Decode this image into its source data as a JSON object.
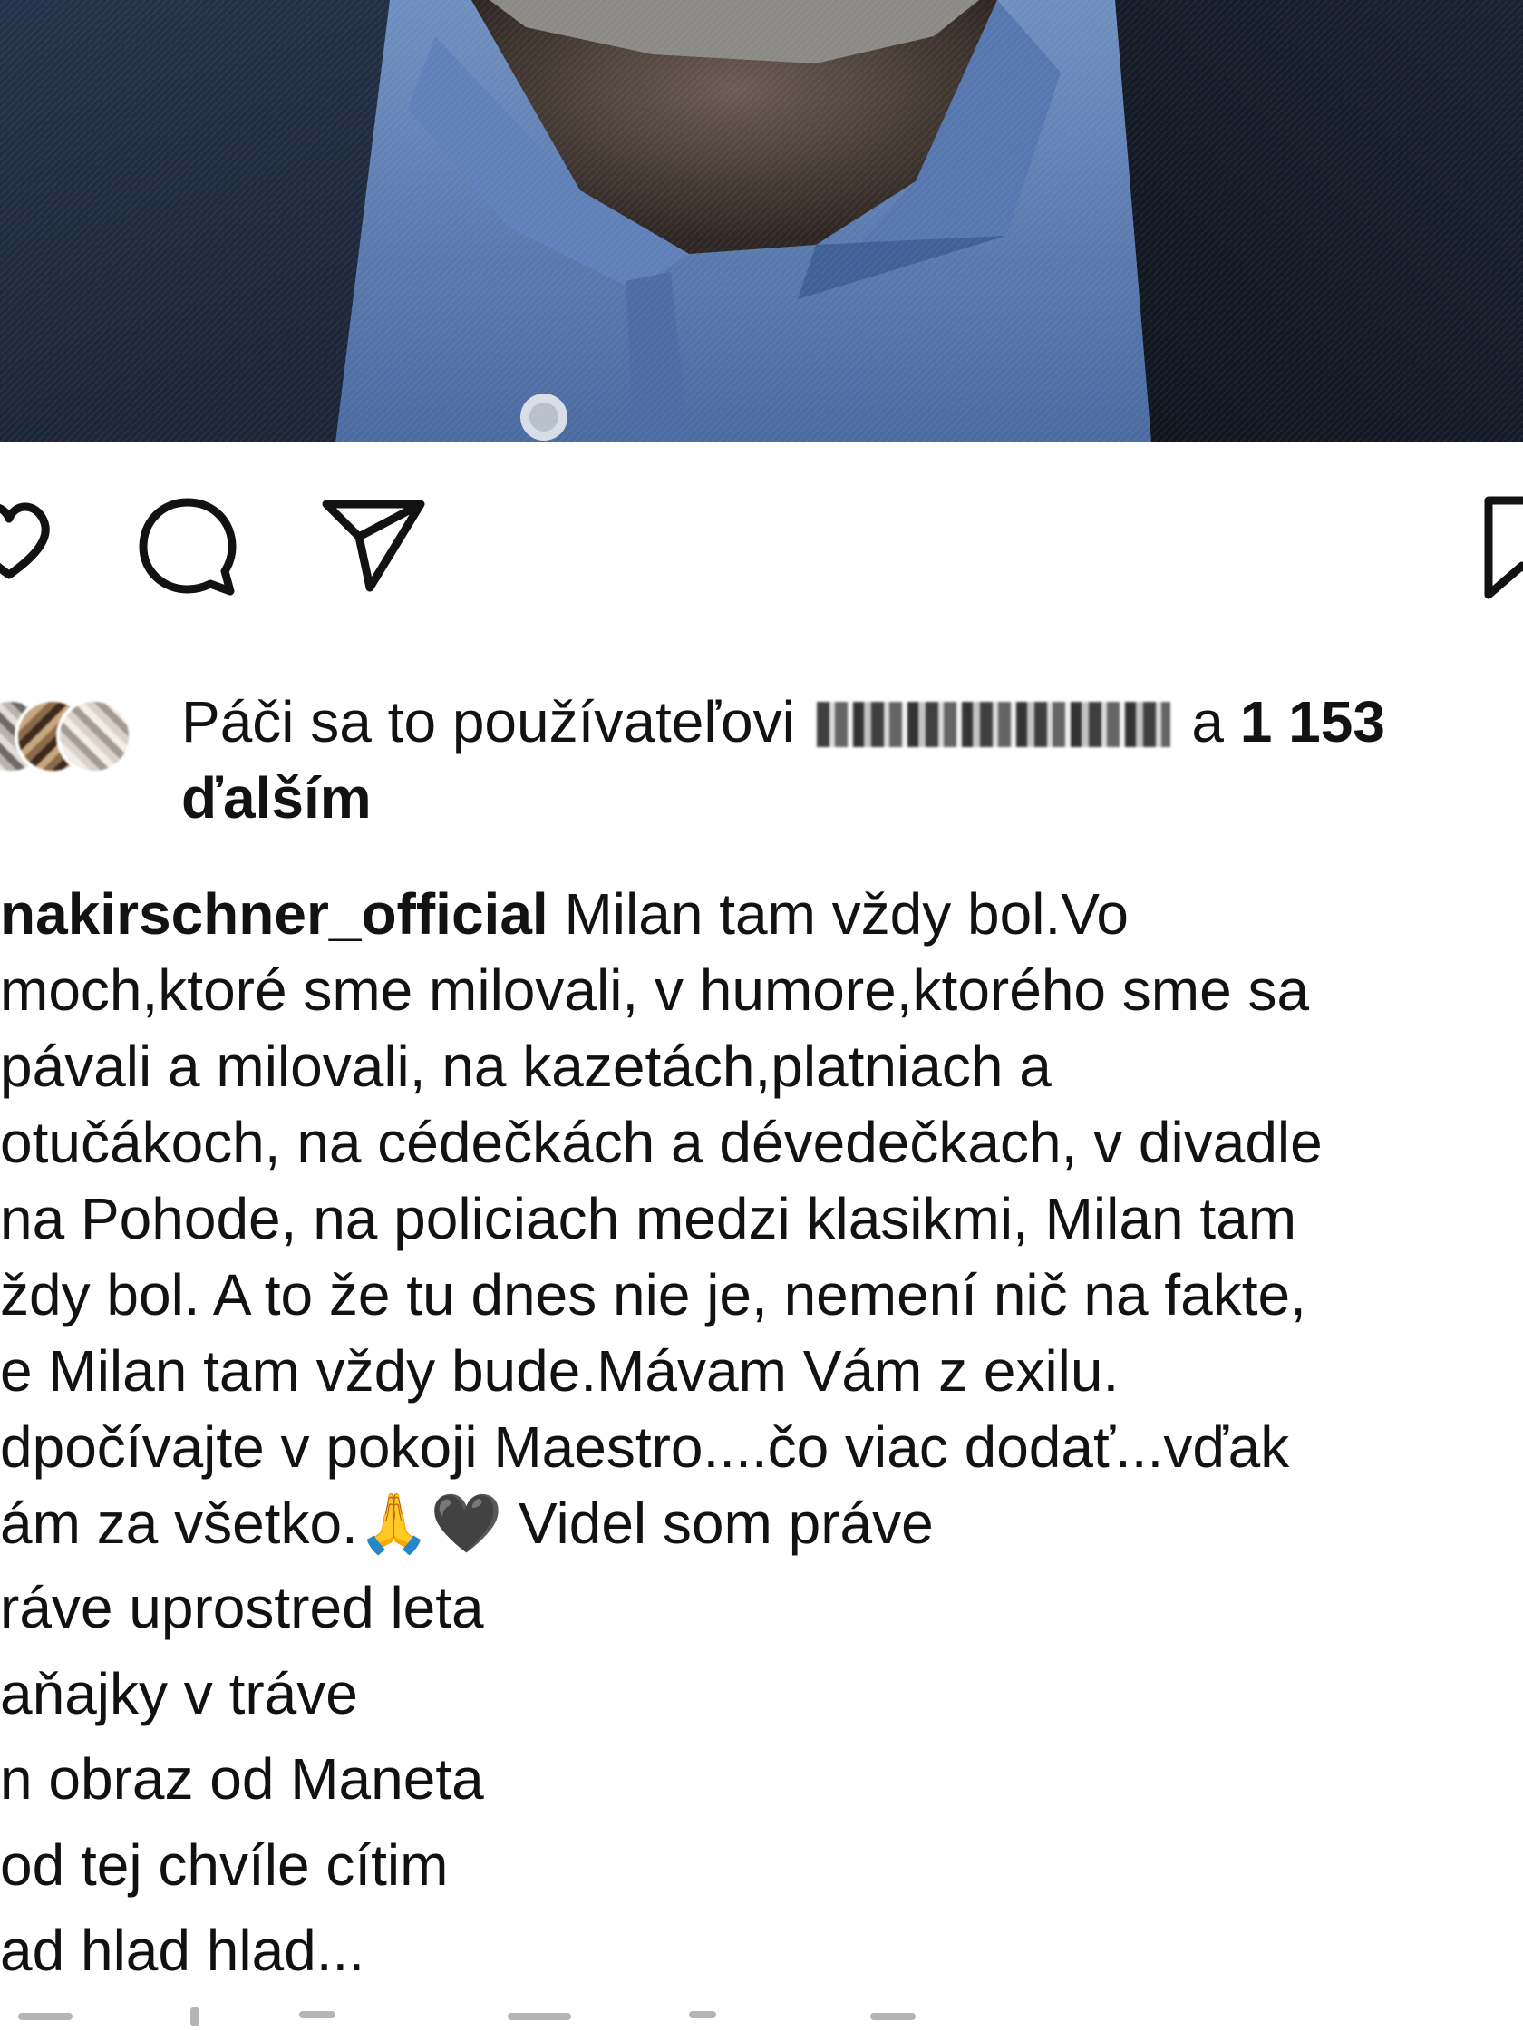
{
  "post": {
    "photo_alt": "portrait photo",
    "actions": {
      "like_icon": "heart-icon",
      "comment_icon": "comment-icon",
      "share_icon": "send-icon",
      "save_icon": "bookmark-icon"
    },
    "likes": {
      "prefix": "Páči sa to používateľovi",
      "connector": "a",
      "count": "1 153",
      "suffix": "ďalším"
    },
    "caption": {
      "username": "nakirschner_official",
      "lines": [
        " Milan tam vždy bol.Vo",
        "moch,ktoré sme milovali, v humore,ktorého sme sa",
        "pávali a milovali, na kazetách,platniach a",
        "otučákoch, na cédečkách a dévedečkach, v divadle",
        " na Pohode, na policiach medzi klasikmi, Milan tam",
        "ždy bol. A to že tu dnes nie je, nemení nič na fakte,",
        "e Milan tam vždy bude.Mávam Vám z exilu.",
        "dpočívajte v pokoji Maestro....čo  viac dodať...vďak",
        "ám za všetko.🙏🖤 Videl som práve"
      ],
      "poem": [
        "ráve uprostred leta",
        "aňajky v tráve",
        "n obraz od Maneta",
        " od tej chvíle cítim",
        "ad hlad hlad..."
      ]
    }
  }
}
